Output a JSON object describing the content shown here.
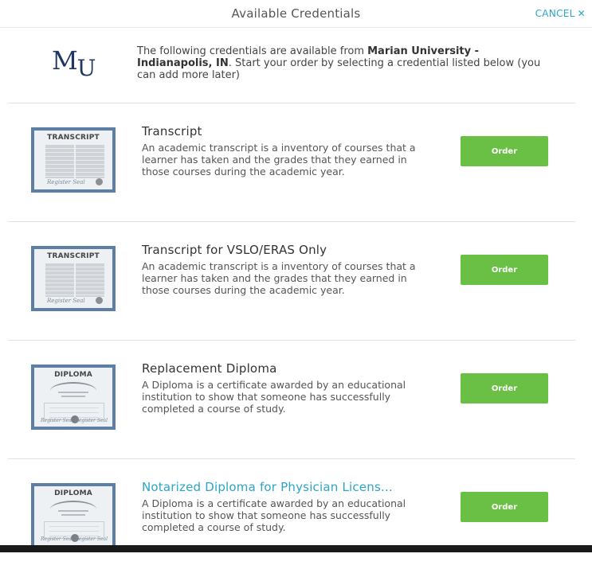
{
  "header": {
    "title": "Available Credentials",
    "cancel_label": "CANCEL",
    "cancel_icon": "✕"
  },
  "intro": {
    "logo_m": "M",
    "logo_u": "U",
    "text_before": "The following credentials are available from ",
    "institution": "Marian University - Indianapolis, IN",
    "text_after": ". Start your order by selecting a credential listed below (you can add more later)"
  },
  "items": [
    {
      "thumb_type": "transcript",
      "thumb_label": "TRANSCRIPT",
      "thumb_sig": "Register Seal",
      "title": "Transcript",
      "description": "An academic transcript is a inventory of courses that a learner has taken and the grades that they earned in those courses during the academic year.",
      "order_label": "Order"
    },
    {
      "thumb_type": "transcript",
      "thumb_label": "TRANSCRIPT",
      "thumb_sig": "Register Seal",
      "title": "Transcript for VSLO/ERAS Only",
      "description": "An academic transcript is a inventory of courses that a learner has taken and the grades that they earned in those courses during the academic year.",
      "order_label": "Order"
    },
    {
      "thumb_type": "diploma",
      "thumb_label": "DIPLOMA",
      "thumb_sig": "Register Seal",
      "title": "Replacement Diploma",
      "description": "A Diploma is a certificate awarded by an educational institution to show that someone has successfully completed a course of study.",
      "order_label": "Order"
    },
    {
      "thumb_type": "diploma",
      "thumb_label": "DIPLOMA",
      "thumb_sig": "Register Seal",
      "title": "Notarized Diploma for Physician Licens...",
      "description": "A Diploma is a certificate awarded by an educational institution to show that someone has successfully completed a course of study.",
      "order_label": "Order"
    }
  ],
  "colors": {
    "accent": "#2aa5c8",
    "order_button": "#6abf45",
    "logo": "#1f3562",
    "thumb_border": "#5d7fa6"
  }
}
